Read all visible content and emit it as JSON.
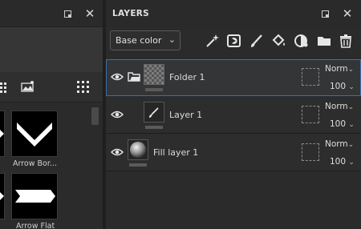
{
  "left_panel": {
    "shapes": [
      {
        "label": "Arrow Bor..."
      },
      {
        "label": "Arrow Flat"
      }
    ]
  },
  "layers_panel": {
    "title": "LAYERS",
    "blend_mode_select": {
      "value": "Base color"
    },
    "toolbar_icons": [
      "magic-wand-icon",
      "mask-icon",
      "brush-icon",
      "paint-bucket-icon",
      "effects-icon",
      "folder-icon",
      "trash-icon"
    ],
    "layers": [
      {
        "name": "Folder 1",
        "blend": "Norm",
        "opacity": "100",
        "type": "folder",
        "selected": true
      },
      {
        "name": "Layer 1",
        "blend": "Norm",
        "opacity": "100",
        "type": "paint",
        "selected": false
      },
      {
        "name": "Fill layer 1",
        "blend": "Norm",
        "opacity": "100",
        "type": "fill",
        "selected": false
      }
    ]
  },
  "colors": {
    "selection_outline": "#3f6fa6",
    "panel_bg": "#2b2b2b"
  }
}
